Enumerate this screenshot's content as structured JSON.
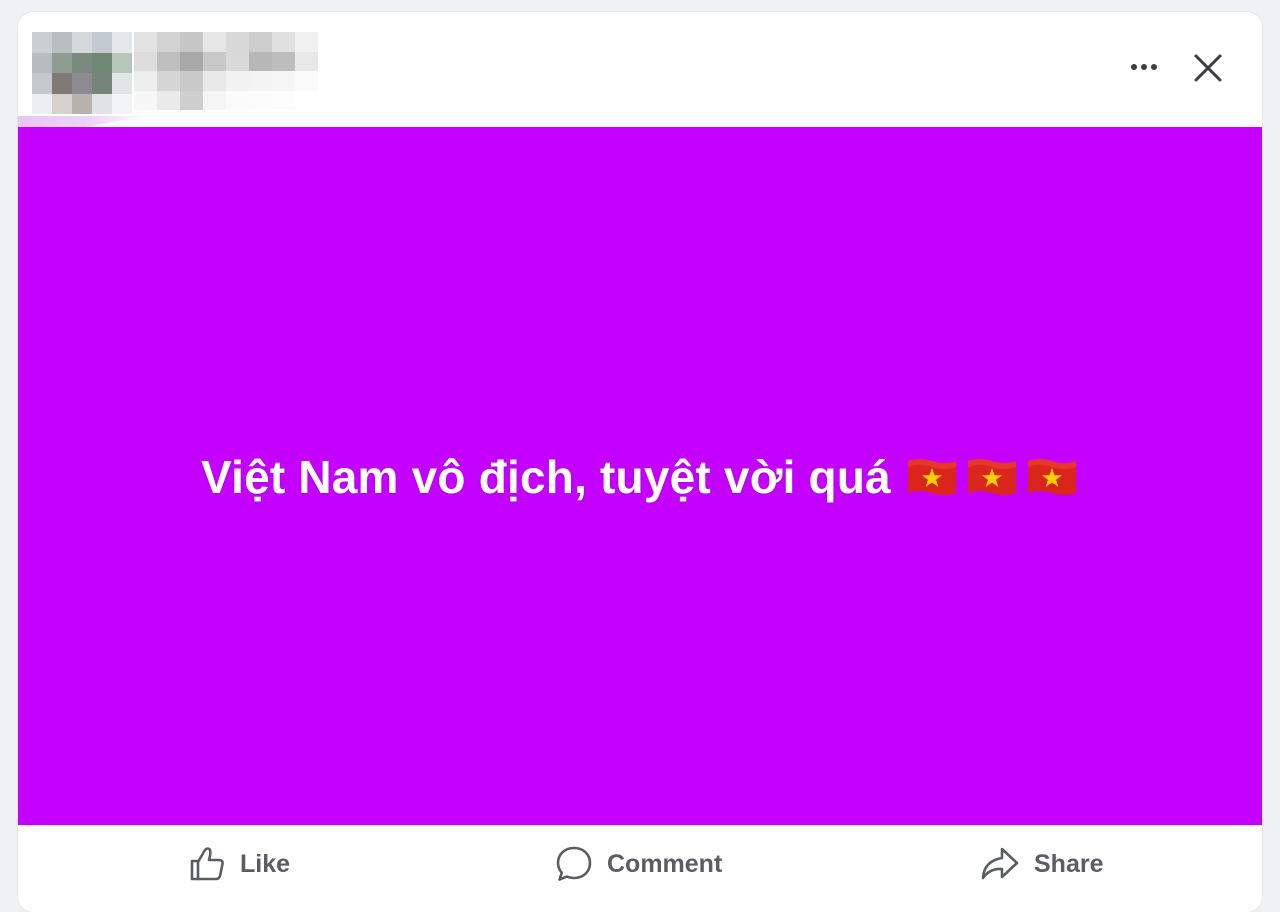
{
  "post": {
    "text": "Việt Nam vô địch, tuyệt vời quá",
    "flags_emoji": "🇻🇳🇻🇳🇻🇳",
    "background_color": "#c400ff",
    "text_color": "#ffffff"
  },
  "header": {
    "author_name_blurred": true,
    "more_icon": "more-horizontal-icon",
    "close_icon": "close-icon"
  },
  "actions": {
    "like_label": "Like",
    "comment_label": "Comment",
    "share_label": "Share",
    "like_icon": "thumbs-up-icon",
    "comment_icon": "comment-bubble-icon",
    "share_icon": "share-arrow-icon",
    "label_color": "#5a5d63"
  },
  "colors": {
    "page_background": "#f0f1f4",
    "card_background": "#ffffff",
    "flag_red": "#da251d",
    "flag_star": "#ffcd00"
  }
}
